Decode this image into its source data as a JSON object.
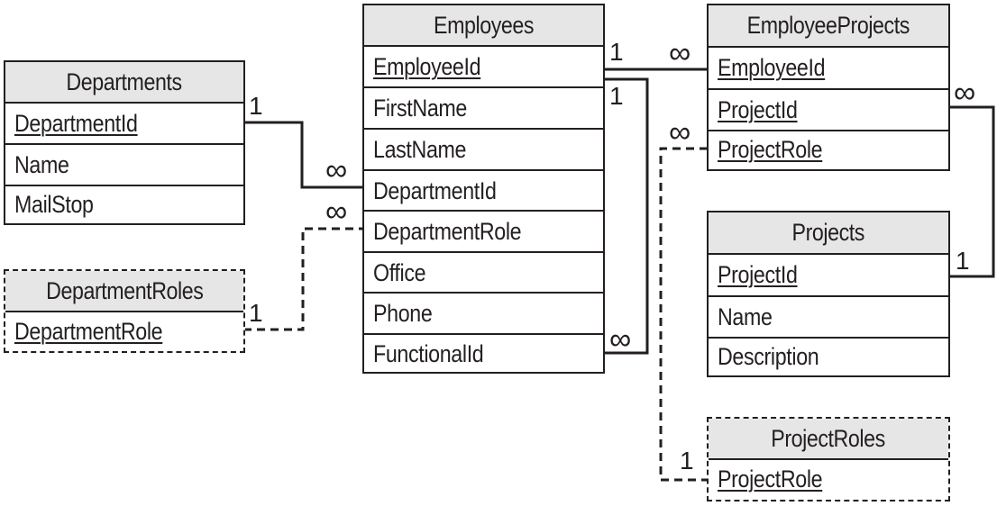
{
  "tables": {
    "departments": {
      "title": "Departments",
      "fields": [
        {
          "name": "DepartmentId",
          "key": true
        },
        {
          "name": "Name",
          "key": false
        },
        {
          "name": "MailStop",
          "key": false
        }
      ]
    },
    "department_roles": {
      "title": "DepartmentRoles",
      "lookup": true,
      "fields": [
        {
          "name": "DepartmentRole",
          "key": true
        }
      ]
    },
    "employees": {
      "title": "Employees",
      "fields": [
        {
          "name": "EmployeeId",
          "key": true
        },
        {
          "name": "FirstName",
          "key": false
        },
        {
          "name": "LastName",
          "key": false
        },
        {
          "name": "DepartmentId",
          "key": false
        },
        {
          "name": "DepartmentRole",
          "key": false
        },
        {
          "name": "Office",
          "key": false
        },
        {
          "name": "Phone",
          "key": false
        },
        {
          "name": "FunctionalId",
          "key": false
        }
      ]
    },
    "employee_projects": {
      "title": "EmployeeProjects",
      "fields": [
        {
          "name": "EmployeeId",
          "key": true
        },
        {
          "name": "ProjectId",
          "key": true
        },
        {
          "name": "ProjectRole",
          "key": true
        }
      ]
    },
    "projects": {
      "title": "Projects",
      "fields": [
        {
          "name": "ProjectId",
          "key": true
        },
        {
          "name": "Name",
          "key": false
        },
        {
          "name": "Description",
          "key": false
        }
      ]
    },
    "project_roles": {
      "title": "ProjectRoles",
      "lookup": true,
      "fields": [
        {
          "name": "ProjectRole",
          "key": true
        }
      ]
    }
  },
  "relationships": [
    {
      "from": "Departments.DepartmentId",
      "to": "Employees.DepartmentId",
      "from_card": "1",
      "to_card": "∞",
      "style": "solid"
    },
    {
      "from": "DepartmentRoles.DepartmentRole",
      "to": "Employees.DepartmentRole",
      "from_card": "1",
      "to_card": "∞",
      "style": "dashed"
    },
    {
      "from": "Employees.EmployeeId",
      "to": "EmployeeProjects.EmployeeId",
      "from_card": "1",
      "to_card": "∞",
      "style": "solid"
    },
    {
      "from": "Employees.EmployeeId",
      "to": "Employees.FunctionalId",
      "from_card": "1",
      "to_card": "∞",
      "style": "solid"
    },
    {
      "from": "Projects.ProjectId",
      "to": "EmployeeProjects.ProjectId",
      "from_card": "1",
      "to_card": "∞",
      "style": "solid"
    },
    {
      "from": "ProjectRoles.ProjectRole",
      "to": "EmployeeProjects.ProjectRole",
      "from_card": "1",
      "to_card": "∞",
      "style": "dashed"
    }
  ],
  "labels": {
    "one": "1",
    "many": "∞"
  }
}
